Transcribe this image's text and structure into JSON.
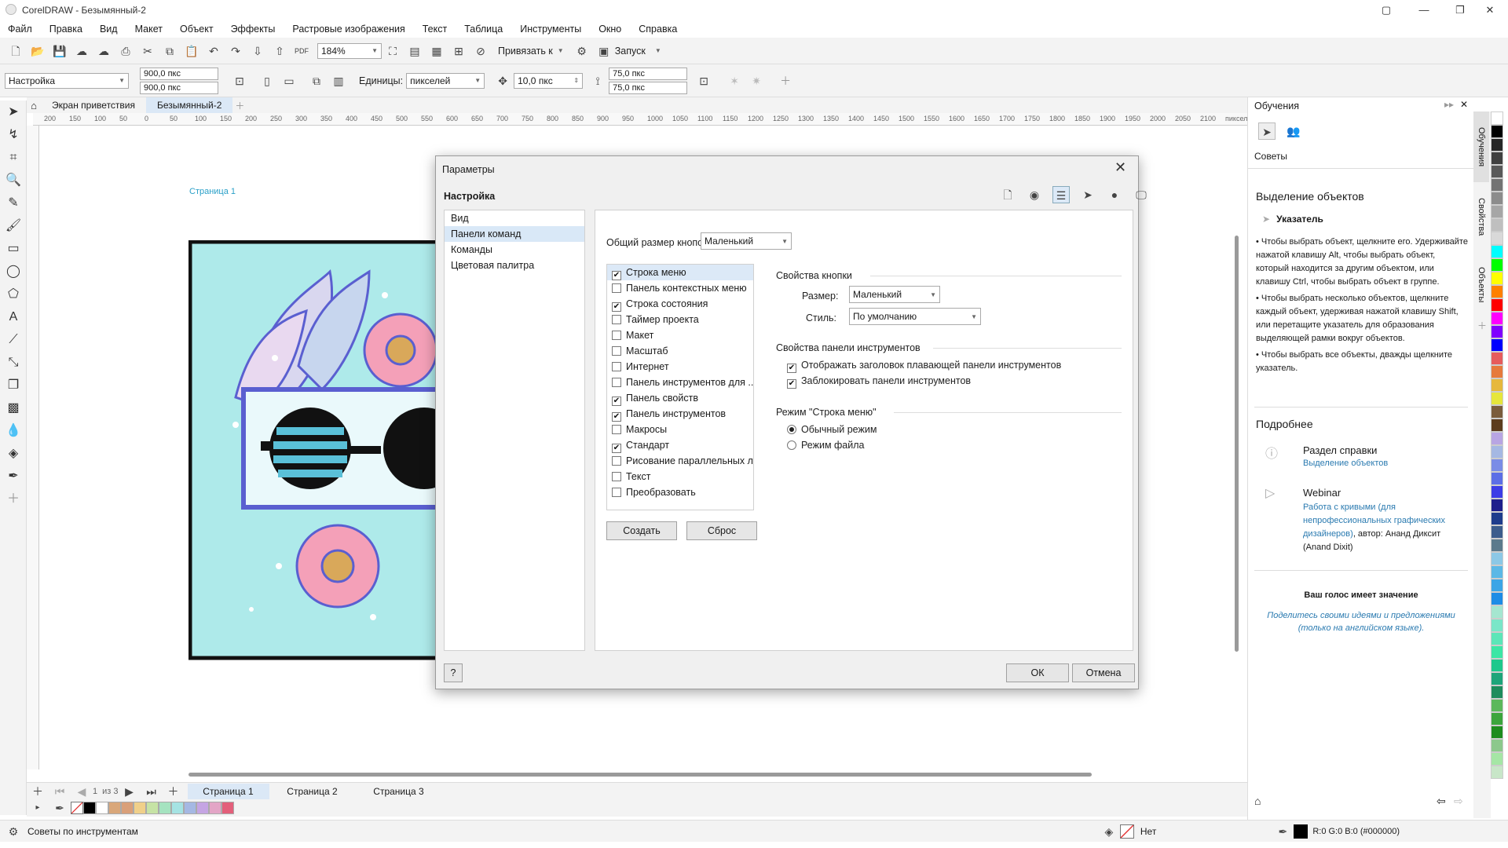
{
  "window": {
    "title": "CorelDRAW - Безымянный-2"
  },
  "menu": [
    "Файл",
    "Правка",
    "Вид",
    "Макет",
    "Объект",
    "Эффекты",
    "Растровые изображения",
    "Текст",
    "Таблица",
    "Инструменты",
    "Окно",
    "Справка"
  ],
  "toolbar": {
    "zoom": "184%",
    "snap_label": "Привязать к",
    "launch_label": "Запуск"
  },
  "propbar": {
    "preset": "Настройка",
    "width": "900,0 пкс",
    "height": "900,0 пкс",
    "units_label": "Единицы:",
    "units_value": "пикселей",
    "nudge": "10,0 пкс",
    "dup_x": "75,0 пкс",
    "dup_y": "75,0 пкс"
  },
  "doctabs": {
    "welcome": "Экран приветствия",
    "doc": "Безымянный-2"
  },
  "ruler_labels": [
    "200",
    "150",
    "100",
    "50",
    "0",
    "50",
    "100",
    "150",
    "200",
    "250",
    "300",
    "350",
    "400",
    "450",
    "500",
    "550",
    "600",
    "650",
    "700",
    "750",
    "800",
    "850",
    "900",
    "950",
    "1000",
    "1050",
    "1100",
    "1150",
    "1200",
    "1250",
    "1300",
    "1350",
    "1400",
    "1450",
    "1500",
    "1550",
    "1600",
    "1650",
    "1700",
    "1750",
    "1800",
    "1850",
    "1900",
    "1950",
    "2000",
    "2050",
    "2100",
    "пикселей"
  ],
  "canvas": {
    "page_label": "Страница 1"
  },
  "dialog": {
    "title": "Параметры",
    "section": "Настройка",
    "nav": [
      "Вид",
      "Панели команд",
      "Команды",
      "Цветовая палитра"
    ],
    "nav_selected": 1,
    "button_size_label": "Общий размер кнопок:",
    "button_size_value": "Маленький",
    "toolbars": [
      {
        "label": "Строка меню",
        "checked": true
      },
      {
        "label": "Панель контекстных меню",
        "checked": false
      },
      {
        "label": "Строка состояния",
        "checked": true
      },
      {
        "label": "Таймер проекта",
        "checked": false
      },
      {
        "label": "Макет",
        "checked": false
      },
      {
        "label": "Масштаб",
        "checked": false
      },
      {
        "label": "Интернет",
        "checked": false
      },
      {
        "label": "Панель инструментов для ...",
        "checked": false
      },
      {
        "label": "Панель свойств",
        "checked": true
      },
      {
        "label": "Панель инструментов",
        "checked": true
      },
      {
        "label": "Макросы",
        "checked": false
      },
      {
        "label": "Стандарт",
        "checked": true
      },
      {
        "label": "Рисование параллельных л...",
        "checked": false
      },
      {
        "label": "Текст",
        "checked": false
      },
      {
        "label": "Преобразовать",
        "checked": false
      }
    ],
    "btn_props": {
      "title": "Свойства кнопки",
      "size_label": "Размер:",
      "size_value": "Маленький",
      "style_label": "Стиль:",
      "style_value": "По умолчанию"
    },
    "tb_props": {
      "title": "Свойства панели инструментов",
      "opt1": "Отображать заголовок плавающей панели инструментов",
      "opt2": "Заблокировать панели инструментов"
    },
    "menu_mode": {
      "title": "Режим \"Строка меню\"",
      "opt1": "Обычный режим",
      "opt2": "Режим файла"
    },
    "create_btn": "Создать",
    "reset_btn": "Сброс",
    "help_btn": "?",
    "ok_btn": "ОК",
    "cancel_btn": "Отмена"
  },
  "learn_panel": {
    "title": "Обучения",
    "tips_label": "Советы",
    "heading": "Выделение объектов",
    "tool_name": "Указатель",
    "bullets": [
      "Чтобы выбрать объект, щелкните его. Удерживайте нажатой клавишу Alt, чтобы выбрать объект, который находится за другим объектом, или клавишу Ctrl, чтобы выбрать объект в группе.",
      "Чтобы выбрать несколько объектов, щелкните каждый объект, удерживая нажатой клавишу Shift, или перетащите указатель для образования выделяющей рамки вокруг объектов.",
      "Чтобы выбрать все объекты, дважды щелкните указатель."
    ],
    "more_label": "Подробнее",
    "help_title": "Раздел справки",
    "help_link": "Выделение объектов",
    "webinar_title": "Webinar",
    "webinar_link": "Работа с кривыми (для непрофессиональных графических дизайнеров)",
    "webinar_author": ", автор: Ананд Диксит (Anand Dixit)",
    "vote_title": "Ваш голос имеет значение",
    "vote_text": "Поделитесь своими идеями и предложениями (только на английском языке)."
  },
  "side_tabs": [
    "Обучения",
    "Свойства",
    "Объекты"
  ],
  "pages": {
    "counter": "1",
    "of": "из 3",
    "tabs": [
      "Страница 1",
      "Страница 2",
      "Страница 3"
    ]
  },
  "status": {
    "hint": "Советы по инструментам",
    "fill": "Нет",
    "color": "R:0 G:0 B:0 (#000000)"
  },
  "colors": {
    "accent": "#3b7dd8",
    "palette_bar": [
      "#000000",
      "#ffffff",
      "#d9a77a",
      "#d9a07a",
      "#f0d08a",
      "#c6e3a5",
      "#a5e3c0",
      "#a5e3e3",
      "#a5b8e3",
      "#c5a5e3",
      "#e3a5c6",
      "#e35f7a"
    ],
    "side_palette": [
      "#ffffff",
      "#000000",
      "#262626",
      "#404040",
      "#595959",
      "#737373",
      "#8c8c8c",
      "#a6a6a6",
      "#bfbfbf",
      "#d9d9d9",
      "#00ffff",
      "#00ff00",
      "#ffff00",
      "#ff8000",
      "#ff0000",
      "#ff00ff",
      "#8000ff",
      "#0000ff",
      "#e65c5c",
      "#e67a3c",
      "#e6b83c",
      "#e6e63c",
      "#7a5c3c",
      "#5c3c1e",
      "#b8a5e3",
      "#a5b8e3",
      "#7a8ce6",
      "#5c6ee6",
      "#3c3ce6",
      "#1e1e8c",
      "#1e3c8c",
      "#3c5c8c",
      "#5c7a8c",
      "#8cc8e6",
      "#5cb8e6",
      "#3ca5e6",
      "#1e8ce6",
      "#a5e6d0",
      "#7ae6c8",
      "#5ce6b8",
      "#3ce6a5",
      "#1ec88c",
      "#1ea57a",
      "#1e8c5c",
      "#5cb85c",
      "#3ca53c",
      "#1e8c1e",
      "#8cc88c",
      "#a5e6a5",
      "#c8e6c8"
    ]
  }
}
